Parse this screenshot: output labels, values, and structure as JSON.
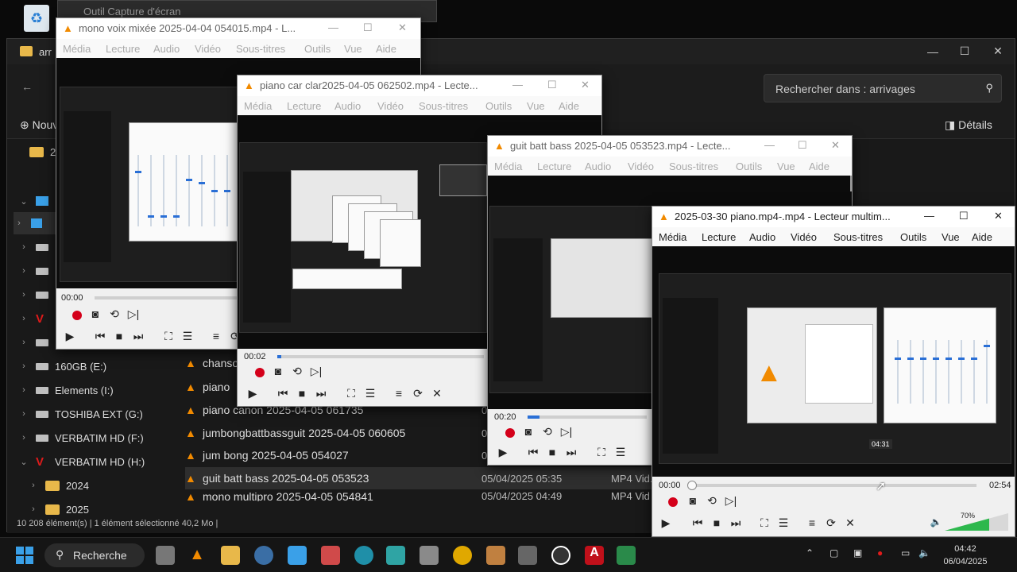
{
  "capture_tool": {
    "title": "Outil Capture d'écran"
  },
  "explorer": {
    "title": "arr",
    "search_placeholder": "Rechercher dans : arrivages",
    "new_label": "Nouveau",
    "details_label": "Détails",
    "sidebar": [
      {
        "label": "20",
        "kind": "folder"
      },
      {
        "label": "160GB (E:)",
        "kind": "drive"
      },
      {
        "label": "Elements (I:)",
        "kind": "drive"
      },
      {
        "label": "TOSHIBA EXT (G:)",
        "kind": "drive"
      },
      {
        "label": "VERBATIM HD (F:)",
        "kind": "drive"
      },
      {
        "label": "VERBATIM HD (H:)",
        "kind": "drive-v"
      },
      {
        "label": "2024",
        "kind": "folder"
      },
      {
        "label": "2025",
        "kind": "folder"
      }
    ],
    "files": [
      {
        "name": "chanso",
        "date": "",
        "type": ""
      },
      {
        "name": "piano",
        "date": "",
        "type": ""
      },
      {
        "name": "piano canon 2025-04-05 061735",
        "date": "05/",
        "type": ""
      },
      {
        "name": "jumbongbattbassguit 2025-04-05 060605",
        "date": "05/",
        "type": ""
      },
      {
        "name": "jum bong 2025-04-05 054027",
        "date": "05/",
        "type": ""
      },
      {
        "name": "guit batt bass 2025-04-05 053523",
        "date": "05/04/2025 05:35",
        "type": "MP4 Vid..."
      },
      {
        "name": "mono multipro 2025-04-05 054841",
        "date": "05/04/2025 04:49",
        "type": "MP4 Vid"
      }
    ],
    "status": "10 208 élément(s)   |   1 élément sélectionné  40,2 Mo   |"
  },
  "vlc_menu": [
    "Média",
    "Lecture",
    "Audio",
    "Vidéo",
    "Sous-titres",
    "Outils",
    "Vue",
    "Aide"
  ],
  "vlc_windows": [
    {
      "title": "mono voix mixée 2025-04-04 054015.mp4 - L...",
      "time": "00:00",
      "progress": 0.0
    },
    {
      "title": "piano car clar2025-04-05 062502.mp4 - Lecte...",
      "time": "00:02",
      "progress": 0.02
    },
    {
      "title": "guit batt bass 2025-04-05 053523.mp4 - Lecte...",
      "time": "00:20",
      "progress": 0.1
    },
    {
      "title": "2025-03-30 piano.mp4-.mp4 - Lecteur multim...",
      "time_elapsed": "00:00",
      "time_total": "02:54",
      "volume": "70%",
      "clock": "04:31",
      "progress": 0.0
    }
  ],
  "taskbar": {
    "search_label": "Recherche",
    "time": "04:42",
    "date": "06/04/2025"
  }
}
